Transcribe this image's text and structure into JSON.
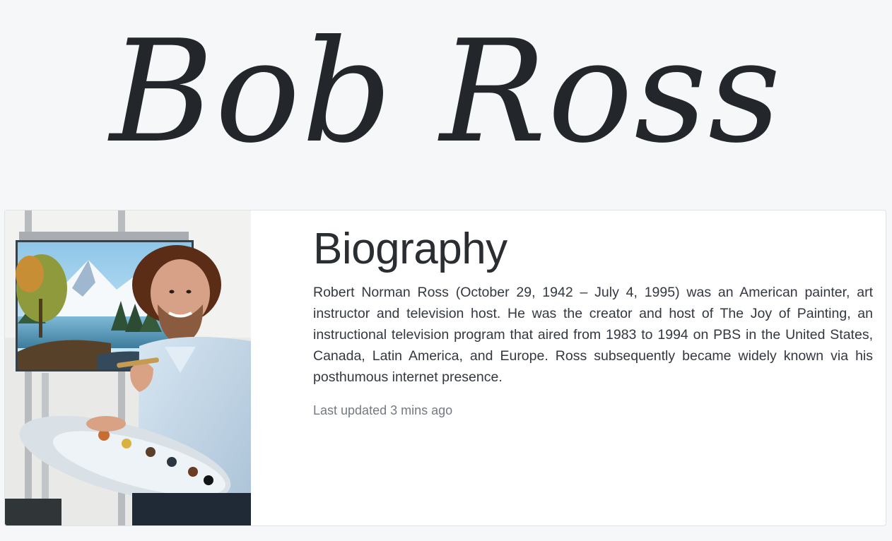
{
  "header": {
    "title": "Bob Ross"
  },
  "card": {
    "image_alt": "Bob Ross painting",
    "title": "Biography",
    "text": "Robert Norman Ross (October 29, 1942 – July 4, 1995) was an American painter, art instructor and television host. He was the creator and host of The Joy of Painting, an instructional television program that aired from 1983 to 1994 on PBS in the United States, Canada, Latin America, and Europe. Ross subsequently became widely known via his posthumous internet presence.",
    "updated": "Last updated 3 mins ago"
  },
  "colors": {
    "page_background": "#f6f7f9",
    "card_background": "#ffffff",
    "heading": "#23272b",
    "muted_text": "#737a82"
  }
}
